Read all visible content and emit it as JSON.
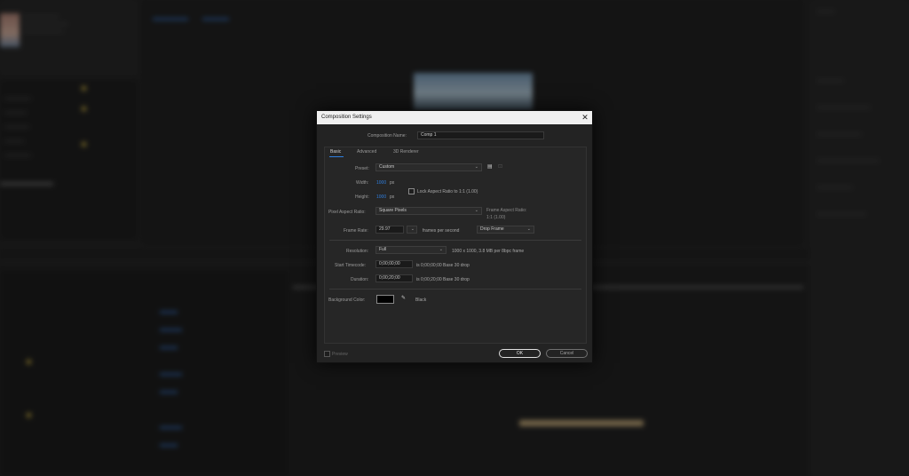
{
  "dialog": {
    "title": "Composition Settings",
    "close_glyph": "✕",
    "comp_name_label": "Composition Name:",
    "comp_name_value": "Comp 1",
    "tabs": [
      {
        "label": "Basic",
        "active": true
      },
      {
        "label": "Advanced",
        "active": false
      },
      {
        "label": "3D Renderer",
        "active": false
      }
    ],
    "preset": {
      "label": "Preset:",
      "value": "Custom"
    },
    "width": {
      "label": "Width:",
      "value": "1000",
      "unit": "px"
    },
    "height": {
      "label": "Height:",
      "value": "1000",
      "unit": "px"
    },
    "lock_aspect_label": "Lock Aspect Ratio to 1:1 (1.00)",
    "pixel_aspect": {
      "label": "Pixel Aspect Ratio:",
      "value": "Square Pixels"
    },
    "frame_aspect": {
      "label": "Frame Aspect Ratio:",
      "value": "1:1 (1.00)"
    },
    "frame_rate": {
      "label": "Frame Rate:",
      "value": "29.97",
      "unit": "frames per second",
      "drop_value": "Drop Frame"
    },
    "resolution": {
      "label": "Resolution:",
      "value": "Full",
      "info": "1000 x 1000, 3.8 MB per 8bpc frame"
    },
    "start_timecode": {
      "label": "Start Timecode:",
      "value": "0;00;00;00",
      "info": "is 0;00;00;00  Base 30  drop"
    },
    "duration": {
      "label": "Duration:",
      "value": "0;00;20;00",
      "info": "is 0;00;20;00  Base 30  drop"
    },
    "background_color": {
      "label": "Background Color:",
      "value": "#000000",
      "name": "Black"
    },
    "preview_label": "Preview",
    "ok_label": "OK",
    "cancel_label": "Cancel"
  },
  "icons": {
    "save_preset": "save-icon",
    "delete_preset": "trash-icon",
    "eyedropper": "eyedropper-icon",
    "chevron": "chevron-down-icon"
  },
  "colors": {
    "accent": "#2f7fe0",
    "titlebar": "#f0f0f0",
    "dialog_bg": "#232323"
  }
}
